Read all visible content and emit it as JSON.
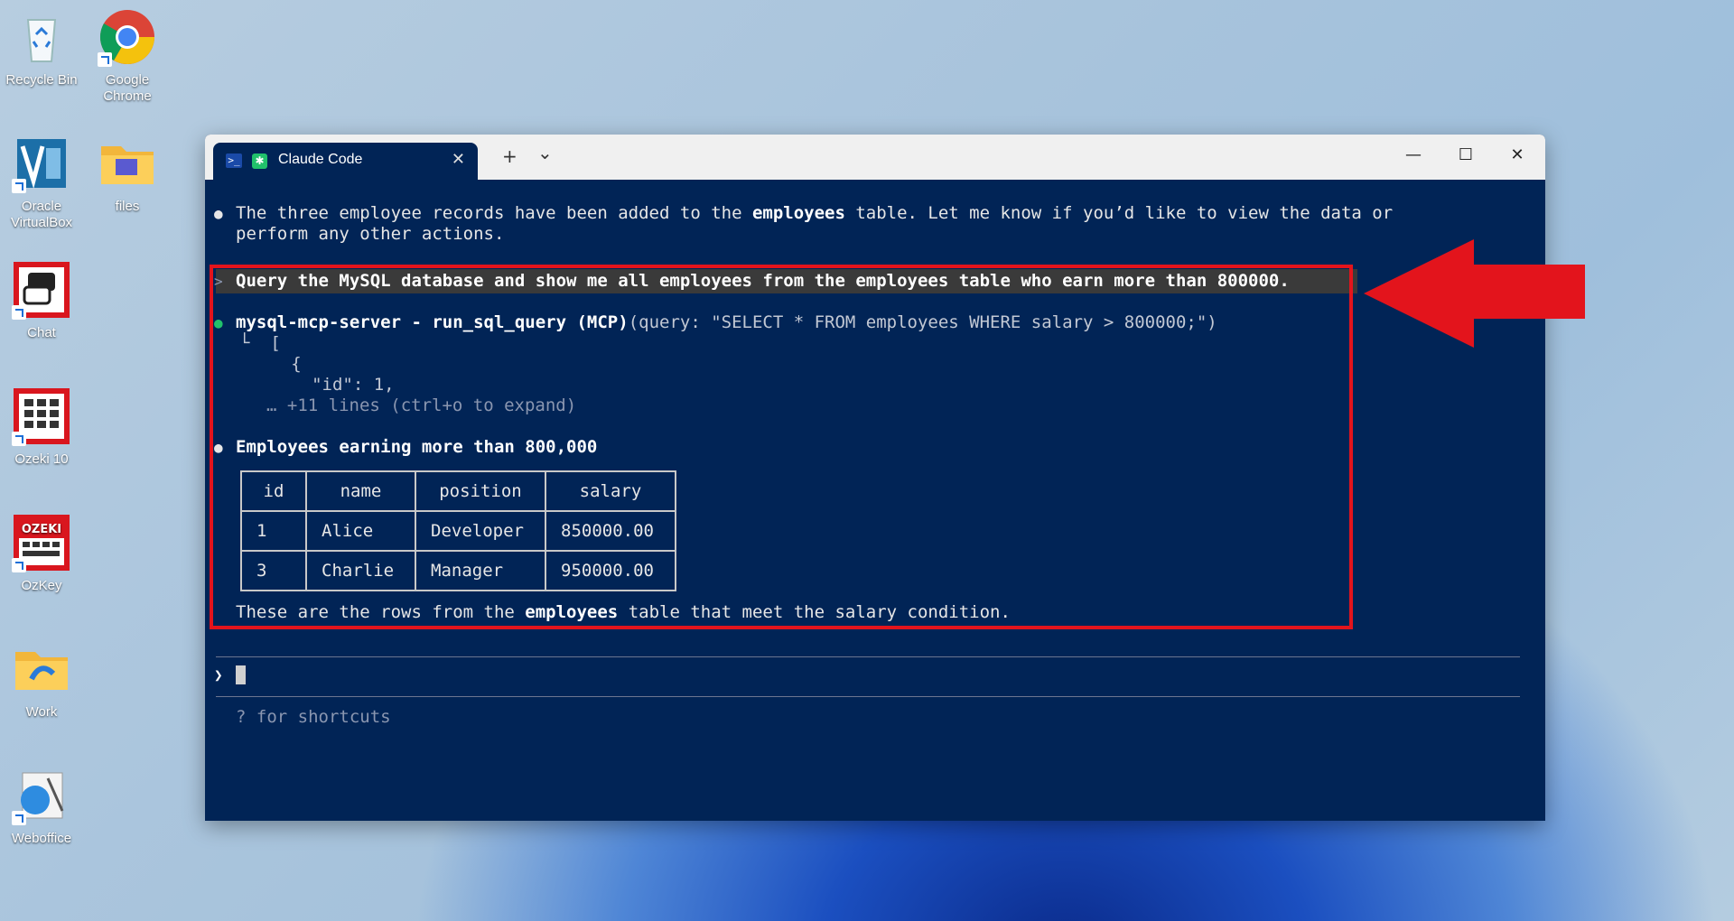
{
  "desktop": {
    "icons": [
      {
        "label": "Recycle Bin"
      },
      {
        "label": "Google Chrome"
      },
      {
        "label": "Oracle VirtualBox"
      },
      {
        "label": "files"
      },
      {
        "label": "Chat"
      },
      {
        "label": "Ozeki 10"
      },
      {
        "label": "OzKey"
      },
      {
        "label": "Work"
      },
      {
        "label": "Weboffice"
      }
    ]
  },
  "window": {
    "tab_title": "Claude Code",
    "new_tab": "+",
    "dropdown": "⌄",
    "minimize": "—",
    "maximize": "☐",
    "close": "✕"
  },
  "terminal": {
    "msg1_line1_pre": "The three employee records have been added to the ",
    "msg1_line1_bold": "employees",
    "msg1_line1_post": " table. Let me know if you’d like to view the data or",
    "msg1_line2": "perform any other actions.",
    "prompt_marker": ">",
    "user_query": "Query the MySQL database and show me all employees from the employees table who earn more than 800000.",
    "tool_name": "mysql-mcp-server - run_sql_query (MCP)",
    "tool_args": "(query: \"SELECT * FROM employees WHERE salary > 800000;\")",
    "result_l1": "└  [",
    "result_l2": "     {",
    "result_l3": "       \"id\": 1,",
    "result_more": "… +11 lines (ctrl+o to expand)",
    "heading": "Employees earning more than 800,000",
    "table": {
      "headers": [
        "id",
        "name",
        "position",
        "salary"
      ],
      "rows": [
        [
          "1",
          "Alice",
          "Developer",
          "850000.00"
        ],
        [
          "3",
          "Charlie",
          "Manager",
          "950000.00"
        ]
      ]
    },
    "summary_pre": "These are the rows from the ",
    "summary_bold": "employees",
    "summary_post": " table that meet the salary condition.",
    "input_prompt": "❯",
    "shortcuts_hint": "? for shortcuts"
  },
  "colors": {
    "terminal_bg": "#012456",
    "highlight": "#e3141c",
    "success_dot": "#21c16b"
  }
}
